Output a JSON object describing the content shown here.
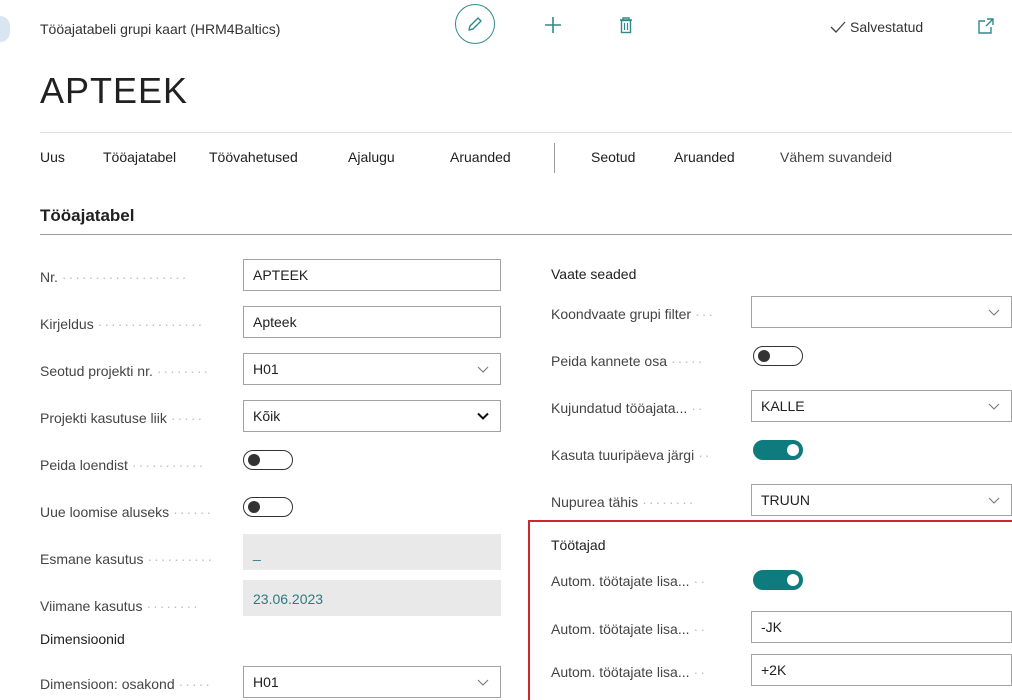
{
  "header": {
    "caption": "Tööajatabeli grupi kaart (HRM4Baltics)",
    "saved_label": "Salvestatud",
    "title": "APTEEK"
  },
  "actions": [
    {
      "label": "Uus"
    },
    {
      "label": "Tööajatabel"
    },
    {
      "label": "Töövahetused"
    },
    {
      "label": "Ajalugu"
    },
    {
      "label": "Aruanded"
    },
    {
      "label": "Seotud"
    },
    {
      "label": "Aruanded"
    },
    {
      "label": "Vähem suvandeid"
    }
  ],
  "section": {
    "title": "Tööajatabel"
  },
  "left_fields": {
    "nr": {
      "label": "Nr.",
      "value": "APTEEK"
    },
    "kirjeldus": {
      "label": "Kirjeldus",
      "value": "Apteek"
    },
    "seotud_projekt": {
      "label": "Seotud projekti nr.",
      "value": "H01"
    },
    "projekti_liik": {
      "label": "Projekti kasutuse liik",
      "value": "Kõik"
    },
    "peida_loendist": {
      "label": "Peida loendist",
      "on": false
    },
    "uue_loomise": {
      "label": "Uue loomise aluseks",
      "on": false
    },
    "esmane": {
      "label": "Esmane kasutus",
      "value": "_"
    },
    "viimane": {
      "label": "Viimane kasutus",
      "value": "23.06.2023"
    }
  },
  "dimensions": {
    "heading": "Dimensioonid",
    "osakond": {
      "label": "Dimensioon: osakond",
      "value": "H01"
    }
  },
  "view_settings": {
    "heading": "Vaate seaded",
    "koondvaate": {
      "label": "Koondvaate grupi filter",
      "value": ""
    },
    "peida_kannete": {
      "label": "Peida kannete osa",
      "on": false
    },
    "kujundatud": {
      "label": "Kujundatud tööajata...",
      "value": "KALLE"
    },
    "tuuripaev": {
      "label": "Kasuta tuuripäeva järgi",
      "on": true
    },
    "nupurea": {
      "label": "Nupurea tähis",
      "value": "TRUUN"
    }
  },
  "employees": {
    "heading": "Töötajad",
    "autom1": {
      "label": "Autom. töötajate lisa...",
      "on": true
    },
    "autom2": {
      "label": "Autom. töötajate lisa...",
      "value": "-JK"
    },
    "autom3": {
      "label": "Autom. töötajate lisa...",
      "value": "+2K"
    }
  },
  "icons": {
    "edit": "pencil-icon",
    "new": "plus-icon",
    "delete": "trash-icon",
    "saved": "checkmark-icon",
    "popout": "popout-icon",
    "dropdown": "chevron-down-icon"
  },
  "colors": {
    "accent": "#0e7c7e",
    "highlight": "#d0262d",
    "readonly_value": "#2a7c80"
  }
}
